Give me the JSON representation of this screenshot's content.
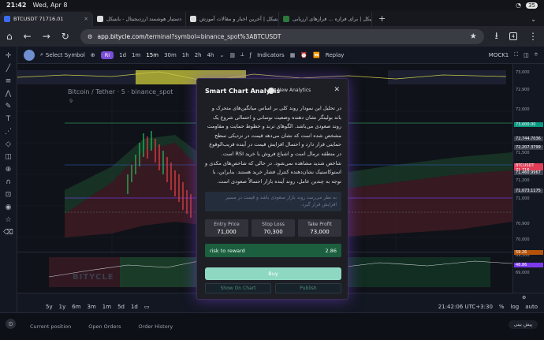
{
  "status_bar": {
    "time": "21:42",
    "date": "Wed, Apr 8",
    "battery": "35"
  },
  "tabs": [
    {
      "title": "BTCUSDT 71716.01"
    },
    {
      "title": "دستیار هوشمند ارزدیجیتال - بایتیکل"
    },
    {
      "title": "بایتیکل | آخرین اخبار و مقالات آموزش..."
    },
    {
      "title": "وبلاگ بایتیکل | برای فرازه ... فرازهای ارزیابی ..."
    }
  ],
  "address_bar": {
    "url_host": "app.bitycle.com",
    "url_path": "/terminal?symbol=binance_spot%3ABTCUSDT",
    "tab_count": "4"
  },
  "toolbar": {
    "select_symbol": "Select Symbol",
    "ri_badge": "RI",
    "timeframes": [
      "1d",
      "1m",
      "15m",
      "30m",
      "1h",
      "2h",
      "4h"
    ],
    "indicators": "Indicators",
    "replay": "Replay",
    "account": "MOCK1"
  },
  "chart": {
    "title": "Bitcoin / Tether · 5 · binance_spot",
    "subtitle": "9",
    "watermark": "BITYCLE",
    "price_labels": [
      "73,000",
      "72,900",
      "72,000",
      "71,500",
      "71,200",
      "71,000",
      "70,900",
      "70,000",
      "69,500",
      "69,000"
    ],
    "price_tags": [
      {
        "text": "73,000.00",
        "color": "#089981"
      },
      {
        "text": "72,744.7036",
        "color": "#3a3f4c"
      },
      {
        "text": "72,207.3799",
        "color": "#3a3f4c"
      },
      {
        "text": "BTCUSDT 71,716",
        "color": "#e03c56"
      },
      {
        "text": "71,460.9967",
        "color": "#3a3f4c"
      },
      {
        "text": "71,073.1175",
        "color": "#3a3f4c"
      }
    ],
    "lower_labels": [
      "71.00",
      "3,091.16",
      "2,082.72",
      "59.26",
      "48.86"
    ],
    "time_labels": [
      "5y",
      "1y",
      "6m",
      "3m",
      "1m",
      "5d",
      "1d"
    ],
    "clock": "21:42:06 UTC+3:30",
    "scale_options": [
      "%",
      "log",
      "auto"
    ]
  },
  "modal": {
    "title": "Smart Chart Analysis",
    "subtitle": "New Analytics",
    "body": "در تحلیل این نمودار روند کلی بر اساس میانگین‌های متحرک و باند بولینگر نشان دهنده وضعیت نوسانی و احتمالی شروع یک روند صعودی می‌باشد. الگوهای ترند و خطوط حمایت و مقاومت مشخص شده است که نشان می‌دهد قیمت در نزدیکی سطح حمایتی قرار دارد و احتمال افزایش قیمت در آینده قریب‌الوقوع در منطقه نرمال است و اشباع فروش با خرید RSI است. شاخص شدید مشاهده نمی‌شود. در حالی که شاخص‌های مکدی و استوکاستیک نشان‌دهنده کنترل فشار خرید هستند. بنابراین، با توجه به چندین عامل، روند آینده بازار احتمالاً صعودی است.",
    "note": "به نظر می‌رسد روند بازار صعودی باشد و قیمت در مسیر افزایش قرار گیرد.",
    "entry_label": "Entry Price",
    "entry_value": "71,000",
    "stop_label": "Stop Loss",
    "stop_value": "70,300",
    "take_label": "Take Profit",
    "take_value": "73,000",
    "rr_label": "risk to reward",
    "rr_value": "2.86",
    "buy_label": "Buy",
    "show_on_chart": "Show On Chart",
    "publish": "Publish"
  },
  "bottom_tabs": [
    "Current position",
    "Open Orders",
    "Order History"
  ],
  "predict_label": "پیش بینی"
}
